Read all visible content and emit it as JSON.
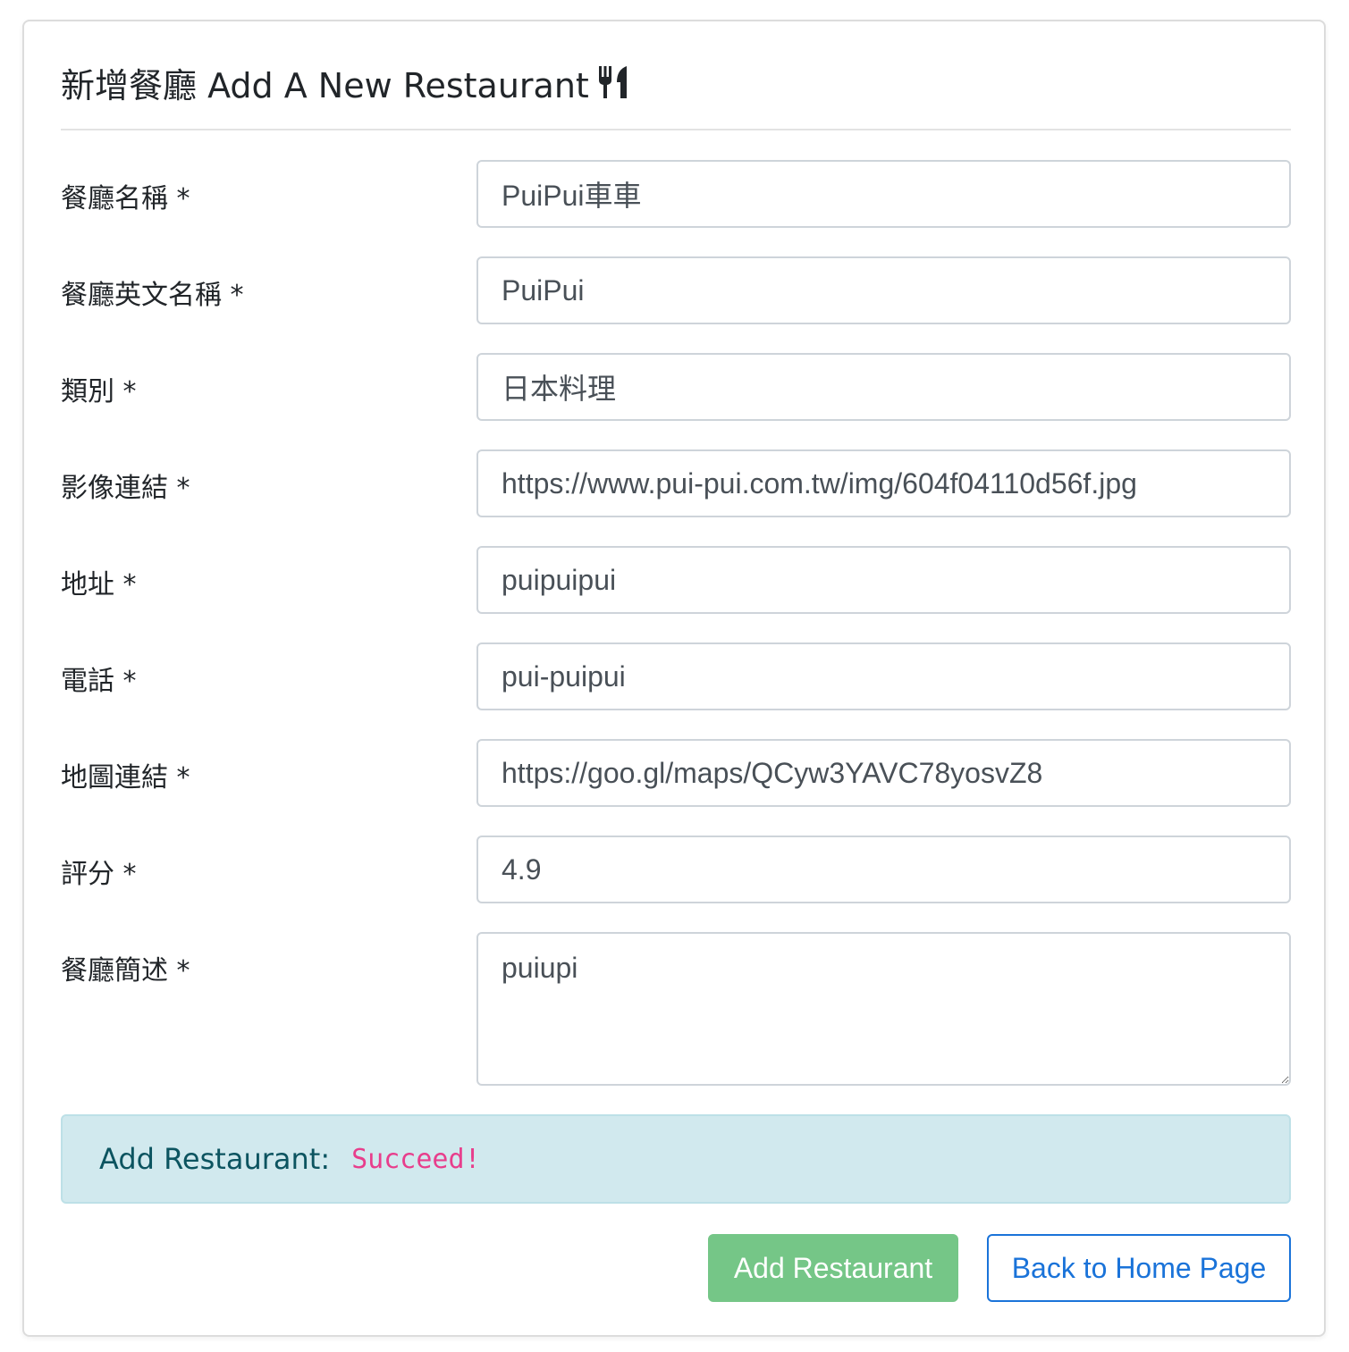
{
  "form": {
    "title": "新增餐廳 Add A New Restaurant",
    "title_icon": "utensils-icon",
    "fields": [
      {
        "label": "餐廳名稱 *",
        "value": "PuiPui車車"
      },
      {
        "label": "餐廳英文名稱 *",
        "value": "PuiPui"
      },
      {
        "label": "類別 *",
        "value": "日本料理"
      },
      {
        "label": "影像連結 *",
        "value": "https://www.pui-pui.com.tw/img/604f04110d56f.jpg"
      },
      {
        "label": "地址 *",
        "value": "puipuipui"
      },
      {
        "label": "電話 *",
        "value": "pui-puipui"
      },
      {
        "label": "地圖連結 *",
        "value": "https://goo.gl/maps/QCyw3YAVC78yosvZ8"
      },
      {
        "label": "評分 *",
        "value": "4.9"
      },
      {
        "label": "餐廳簡述 *",
        "value": "puiupi"
      }
    ]
  },
  "alert": {
    "label": "Add Restaurant:",
    "status": "Succeed!"
  },
  "buttons": {
    "add": "Add Restaurant",
    "home": "Back to Home Page"
  },
  "colors": {
    "alert_bg": "#d1e9ee",
    "status_text": "#e83e8c",
    "add_button": "#75c687",
    "home_button": "#1a73d9"
  }
}
